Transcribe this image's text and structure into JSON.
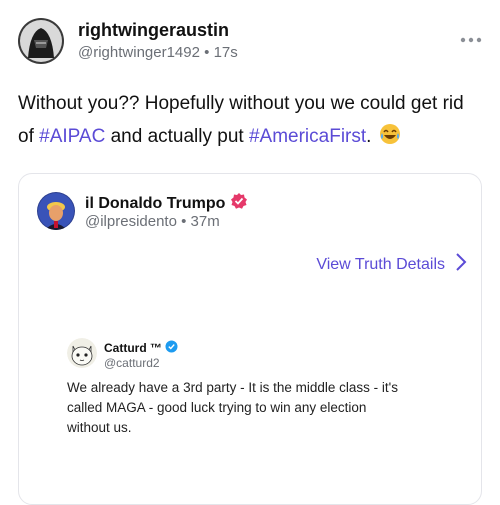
{
  "post": {
    "author_name": "rightwingeraustin",
    "author_handle": "@rightwinger1492",
    "time": "17s",
    "body_parts": {
      "t1": "Without you?? Hopefully without you we could get rid of ",
      "tag1": "#AIPAC",
      "t2": " and actually put ",
      "tag2": "#AmericaFirst",
      "t3": ". "
    },
    "emoji": "laughing-tears-emoji",
    "more_icon": "more-horizontal-icon"
  },
  "quote": {
    "author_name": "il Donaldo Trumpo",
    "author_handle": "@ilpresidento",
    "time": "37m",
    "verified_icon": "verified-badge-icon",
    "view_details_label": "View Truth Details",
    "chevron_icon": "chevron-right-icon",
    "accent": "#5b4bd6",
    "embedded": {
      "name": "Catturd ™",
      "handle": "@catturd2",
      "text": "We already have a 3rd party - It is the middle class - it's called MAGA - good luck trying to win any election without us."
    }
  },
  "colors": {
    "link": "#5b4bd6",
    "muted": "#6b6f76",
    "verified_pink": "#e5396a",
    "verified_blue": "#1d9bf0"
  }
}
